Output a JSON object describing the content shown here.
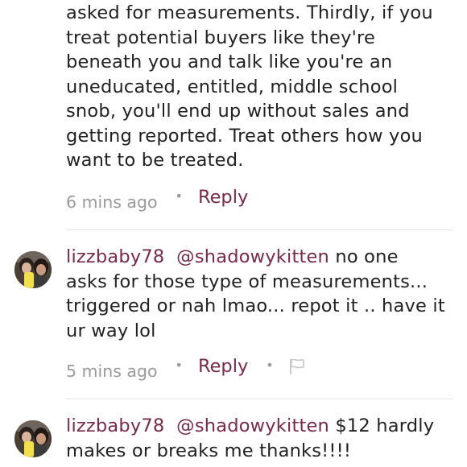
{
  "comments": [
    {
      "lines": [
        "asked for measurements. Thirdly, if you",
        "treat potential buyers like they're",
        "beneath you and talk like you're an",
        "uneducated, entitled, middle school",
        "snob, you'll end up without sales and",
        "getting reported. Treat others how you",
        "want to be treated."
      ],
      "time": "6 mins ago",
      "reply_label": "Reply"
    },
    {
      "username": "lizzbaby78",
      "mention": "@shadowykitten",
      "text_first": " no one",
      "lines": [
        "asks for those type of measurements...",
        "triggered or nah lmao... repot it .. have it",
        "ur way lol"
      ],
      "time": "5 mins ago",
      "reply_label": "Reply",
      "flag_icon": "flag-icon"
    },
    {
      "username": "lizzbaby78",
      "mention": "@shadowykitten",
      "text_first": " $12 hardly",
      "lines": [
        "makes or breaks me thanks!!!!"
      ]
    }
  ],
  "colors": {
    "username": "#7a2a45",
    "reply": "#7a2a45",
    "meta": "#9a9a9a",
    "text": "#222222",
    "divider": "#e3e3e3"
  }
}
